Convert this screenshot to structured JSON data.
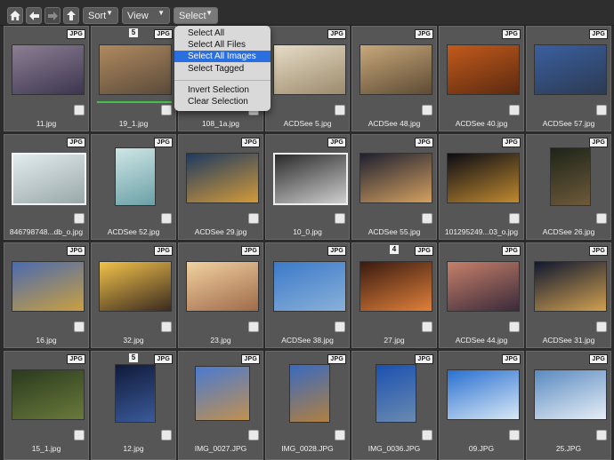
{
  "toolbar": {
    "sort_label": "Sort",
    "view_label": "View",
    "select_label": "Select"
  },
  "select_menu": {
    "items": [
      {
        "label": "Select All",
        "highlighted": false
      },
      {
        "label": "Select All Files",
        "highlighted": false
      },
      {
        "label": "Select All Images",
        "highlighted": true
      },
      {
        "label": "Select Tagged",
        "highlighted": false
      },
      {
        "label": "Invert Selection",
        "highlighted": false
      },
      {
        "label": "Clear Selection",
        "highlighted": false
      }
    ]
  },
  "colors": {
    "menu_highlight": "#2a6fe0",
    "tagged_bar": "#3ec44a"
  },
  "files": [
    {
      "name": "11.jpg",
      "type": "JPG",
      "colors": [
        "#8d7f93",
        "#3c3550"
      ]
    },
    {
      "name": "19_1.jpg",
      "type": "JPG",
      "number": "5",
      "tagged": true,
      "colors": [
        "#b08a5f",
        "#5a4a3a"
      ]
    },
    {
      "name": "108_1a.jpg",
      "type": "JPG",
      "colors": [
        "#888",
        "#555"
      ]
    },
    {
      "name": "ACDSee 5.jpg",
      "type": "JPG",
      "colors": [
        "#e6dcc6",
        "#9c8a6c"
      ]
    },
    {
      "name": "ACDSee 48.jpg",
      "type": "JPG",
      "colors": [
        "#c7a87a",
        "#5e4b34"
      ]
    },
    {
      "name": "ACDSee 40.jpg",
      "type": "JPG",
      "colors": [
        "#c25a1c",
        "#5c2a10"
      ]
    },
    {
      "name": "ACDSee 57.jpg",
      "type": "JPG",
      "colors": [
        "#3a5fa0",
        "#2c3a52"
      ]
    },
    {
      "name": "846798748...db_o.jpg",
      "type": "JPG",
      "colors": [
        "#e2ecee",
        "#9aa8aa"
      ]
    },
    {
      "name": "ACDSee 52.jpg",
      "type": "JPG",
      "colors": [
        "#cfe6e6",
        "#6aa0a6"
      ]
    },
    {
      "name": "ACDSee 29.jpg",
      "type": "JPG",
      "colors": [
        "#1e3a60",
        "#d39a3a"
      ]
    },
    {
      "name": "10_0.jpg",
      "type": "JPG",
      "colors": [
        "#2a2a2a",
        "#cfcfcf"
      ]
    },
    {
      "name": "ACDSee 55.jpg",
      "type": "JPG",
      "colors": [
        "#1e2030",
        "#d4a060"
      ]
    },
    {
      "name": "101295249...03_o.jpg",
      "type": "JPG",
      "colors": [
        "#0b0b14",
        "#c08a30"
      ]
    },
    {
      "name": "ACDSee 26.jpg",
      "type": "JPG",
      "colors": [
        "#1c2418",
        "#6e5a3a"
      ]
    },
    {
      "name": "16.jpg",
      "type": "JPG",
      "colors": [
        "#4a6ab0",
        "#caa040"
      ]
    },
    {
      "name": "32.jpg",
      "type": "JPG",
      "colors": [
        "#f2c24a",
        "#3a2a20"
      ]
    },
    {
      "name": "23.jpg",
      "type": "JPG",
      "colors": [
        "#f0d2a0",
        "#a06a4a"
      ]
    },
    {
      "name": "ACDSee 38.jpg",
      "type": "JPG",
      "colors": [
        "#3a7ac8",
        "#8ab0da"
      ]
    },
    {
      "name": "27.jpg",
      "type": "JPG",
      "number": "4",
      "colors": [
        "#3a1a10",
        "#e0803a"
      ]
    },
    {
      "name": "ACDSee 44.jpg",
      "type": "JPG",
      "colors": [
        "#c6806a",
        "#3a2a3a"
      ]
    },
    {
      "name": "ACDSee 31.jpg",
      "type": "JPG",
      "colors": [
        "#101830",
        "#d0a050"
      ]
    },
    {
      "name": "15_1.jpg",
      "type": "JPG",
      "colors": [
        "#2a3a1e",
        "#6a7a3a"
      ]
    },
    {
      "name": "12.jpg",
      "type": "JPG",
      "number": "5",
      "colors": [
        "#101a3a",
        "#3a5a9a"
      ]
    },
    {
      "name": "IMG_0027.JPG",
      "type": "JPG",
      "colors": [
        "#4a7ad0",
        "#c09050"
      ]
    },
    {
      "name": "IMG_0028.JPG",
      "type": "JPG",
      "colors": [
        "#3a6ac0",
        "#b08040"
      ]
    },
    {
      "name": "IMG_0036.JPG",
      "type": "JPG",
      "colors": [
        "#1a50b0",
        "#6a8ab0"
      ]
    },
    {
      "name": "09.JPG",
      "type": "JPG",
      "colors": [
        "#2a70d0",
        "#d8e8f6"
      ]
    },
    {
      "name": "25.JPG",
      "type": "JPG",
      "colors": [
        "#5a8ac0",
        "#e6eef6"
      ]
    }
  ]
}
